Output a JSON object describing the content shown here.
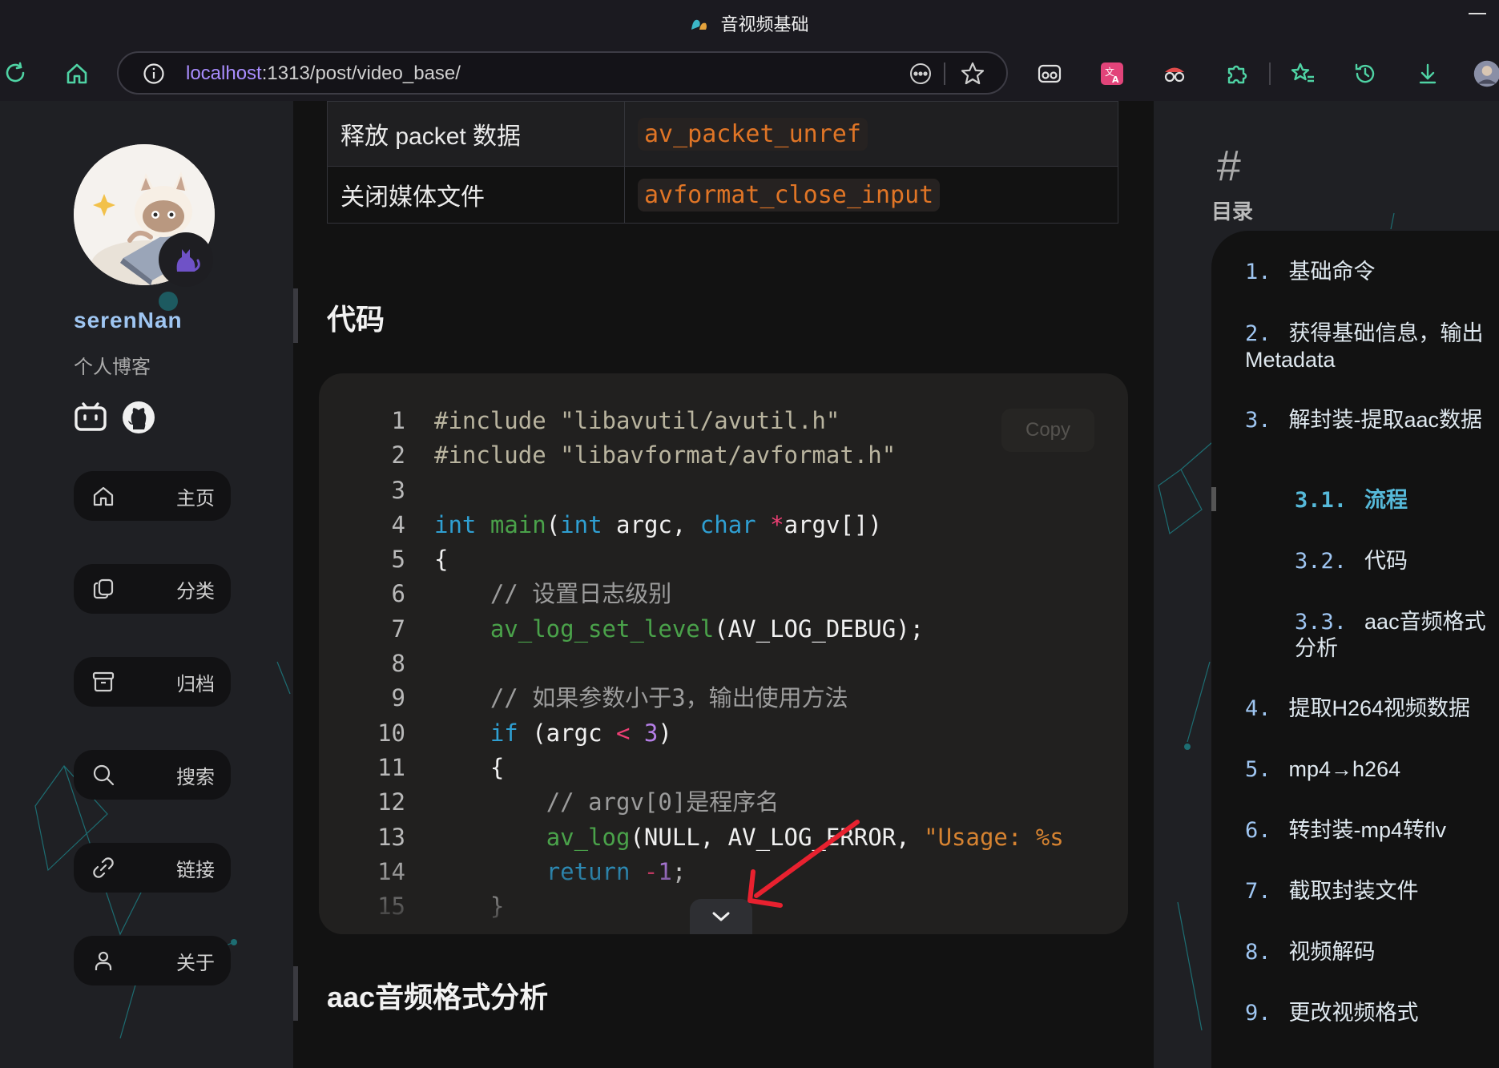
{
  "window": {
    "title": "音视频基础"
  },
  "toolbar": {
    "url_host": "localhost",
    "url_path": ":1313/post/video_base/"
  },
  "sidebar": {
    "username": "serenNan",
    "bio": "个人博客",
    "nav": [
      {
        "label": "主页",
        "icon": "home-icon"
      },
      {
        "label": "分类",
        "icon": "copy-icon"
      },
      {
        "label": "归档",
        "icon": "archive-icon"
      },
      {
        "label": "搜索",
        "icon": "search-icon"
      },
      {
        "label": "链接",
        "icon": "link-icon"
      },
      {
        "label": "关于",
        "icon": "user-icon"
      }
    ]
  },
  "content": {
    "table": [
      {
        "desc": "释放 packet 数据",
        "func": "av_packet_unref"
      },
      {
        "desc": "关闭媒体文件",
        "func": "avformat_close_input"
      }
    ],
    "heading_code": "代码",
    "copy_label": "Copy",
    "code_line_numbers": [
      "1",
      "2",
      "3",
      "4",
      "5",
      "6",
      "7",
      "8",
      "9",
      "10",
      "11",
      "12",
      "13",
      "14",
      "15"
    ],
    "heading_aac": "aac音频格式分析"
  },
  "toc": {
    "title": "目录",
    "items": [
      {
        "num": "1.",
        "label": "基础命令"
      },
      {
        "num": "2.",
        "label": "获得基础信息，输出Metadata"
      },
      {
        "num": "3.",
        "label": "解封装-提取aac数据"
      },
      {
        "num": "3.1.",
        "label": "流程"
      },
      {
        "num": "3.2.",
        "label": "代码"
      },
      {
        "num": "3.3.",
        "label": "aac音频格式分析"
      },
      {
        "num": "4.",
        "label": "提取H264视频数据"
      },
      {
        "num": "5.",
        "label": "mp4→h264"
      },
      {
        "num": "6.",
        "label": "转封装-mp4转flv"
      },
      {
        "num": "7.",
        "label": "截取封装文件"
      },
      {
        "num": "8.",
        "label": "视频解码"
      },
      {
        "num": "9.",
        "label": "更改视频格式"
      }
    ]
  },
  "colors": {
    "accent": "#9fc6f2",
    "active_toc": "#56b9d9",
    "inline_code": "#e07526"
  }
}
